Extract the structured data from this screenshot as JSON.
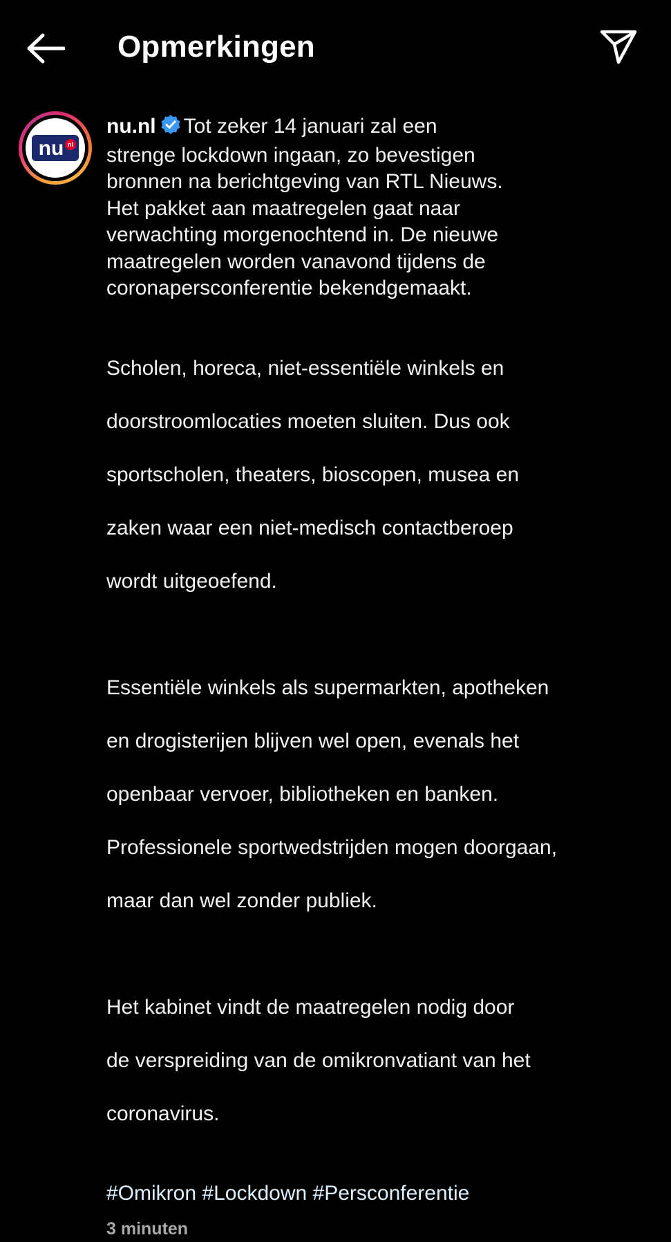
{
  "header": {
    "title": "Opmerkingen",
    "back_icon": "arrow-left-icon",
    "share_icon": "paper-plane-icon"
  },
  "comment": {
    "username": "nu.nl",
    "avatar_text": "nu",
    "avatar_badge": "nl",
    "verified_color": "#3897f0",
    "paragraphs": [
      [
        "Tot zeker 14 januari zal een",
        "strenge lockdown ingaan, zo bevestigen",
        "bronnen na berichtgeving van RTL Nieuws.",
        "Het pakket aan maatregelen gaat naar",
        "verwachting morgenochtend in. De nieuwe",
        "maatregelen worden vanavond tijdens de",
        "coronapersconferentie bekendgemaakt."
      ],
      [
        "Scholen, horeca, niet-essentiële winkels en",
        "doorstroomlocaties moeten sluiten. Dus ook",
        "sportscholen, theaters, bioscopen, musea en",
        "zaken waar een niet-medisch contactberoep",
        "wordt uitgeoefend."
      ],
      [
        "Essentiële winkels als supermarkten, apotheken",
        "en drogisterijen blijven wel open, evenals het",
        "openbaar vervoer, bibliotheken en banken.",
        "Professionele sportwedstrijden mogen doorgaan,",
        "maar dan wel zonder publiek."
      ],
      [
        "Het kabinet vindt de maatregelen nodig door",
        "de verspreiding van de omikronvatiant van het",
        "coronavirus."
      ]
    ],
    "hashtags": [
      "#Omikron",
      "#Lockdown",
      "#Persconferentie"
    ],
    "timestamp": "3 minuten"
  },
  "colors": {
    "background": "#000000",
    "text": "#f2f2f2",
    "hashtag": "#e0f1ff",
    "muted": "#a8a8a8",
    "brand_nu": "#1a2a6c",
    "brand_badge": "#e0002a"
  }
}
